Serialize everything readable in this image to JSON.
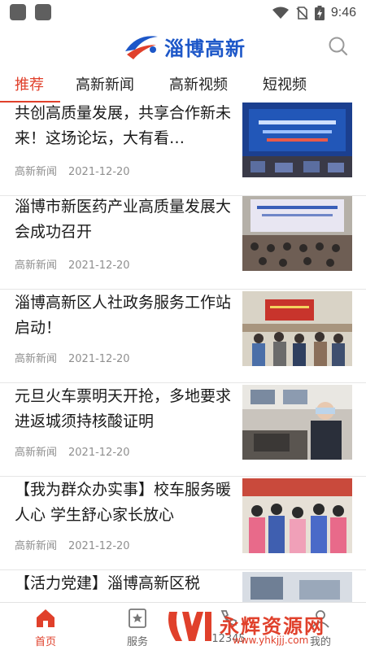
{
  "status_bar": {
    "time": "9:46"
  },
  "header": {
    "logo_text": "淄博高新",
    "search_icon": "search-icon"
  },
  "tabs": [
    {
      "label": "推荐",
      "active": true
    },
    {
      "label": "高新新闻"
    },
    {
      "label": "高新视频"
    },
    {
      "label": "短视频"
    }
  ],
  "news": [
    {
      "title": "共创高质量发展，共享合作新未来！这场论坛，大有看…",
      "source": "高新新闻",
      "date": "2021-12-20"
    },
    {
      "title": "淄博市新医药产业高质量发展大会成功召开",
      "source": "高新新闻",
      "date": "2021-12-20"
    },
    {
      "title": "淄博高新区人社政务服务工作站启动！",
      "source": "高新新闻",
      "date": "2021-12-20"
    },
    {
      "title": "元旦火车票明天开抢，多地要求进返城须持核酸证明",
      "source": "高新新闻",
      "date": "2021-12-20"
    },
    {
      "title": "【我为群众办实事】校车服务暖人心 学生舒心家长放心",
      "source": "高新新闻",
      "date": "2021-12-20"
    },
    {
      "title": "【活力党建】淄博高新区税",
      "source": "",
      "date": ""
    }
  ],
  "bottom_nav": [
    {
      "label": "首页",
      "icon": "home-icon",
      "active": true
    },
    {
      "label": "服务",
      "icon": "service-star-icon"
    },
    {
      "label": "12345",
      "icon": "hotline-icon"
    },
    {
      "label": "我的",
      "icon": "profile-icon"
    }
  ],
  "watermark": {
    "name": "永辉资源网",
    "url": "www.yhkjjj.com"
  },
  "colors": {
    "accent": "#e0402b",
    "brand_blue": "#1d57c8",
    "meta_gray": "#8f8f8f"
  }
}
